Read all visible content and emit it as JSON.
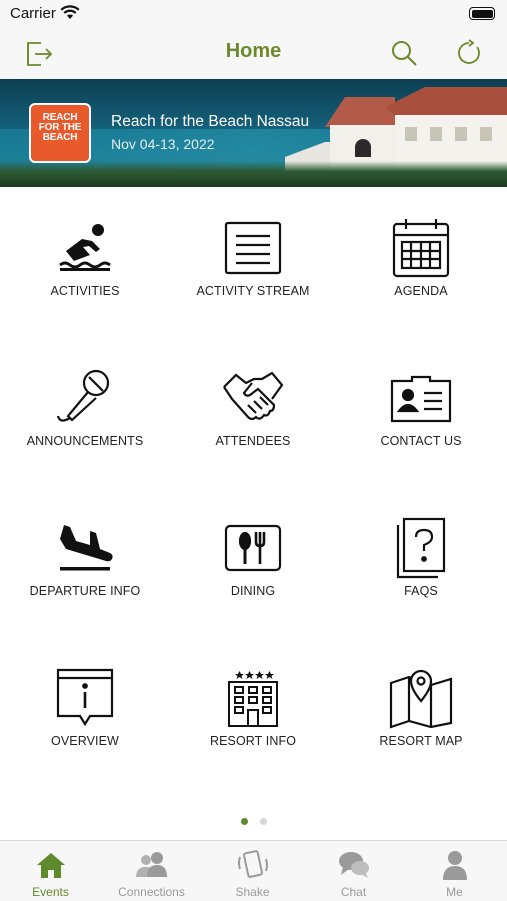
{
  "status_bar": {
    "carrier": "Carrier"
  },
  "nav": {
    "title": "Home"
  },
  "banner": {
    "title": "Reach for the Beach Nassau",
    "date": "Nov 04-13, 2022",
    "logo_text": "REACH FOR THE BEACH"
  },
  "grid": [
    {
      "label": "ACTIVITIES",
      "icon": "swimmer-icon"
    },
    {
      "label": "ACTIVITY STREAM",
      "icon": "list-lines-icon"
    },
    {
      "label": "AGENDA",
      "icon": "calendar-icon"
    },
    {
      "label": "ANNOUNCEMENTS",
      "icon": "microphone-icon"
    },
    {
      "label": "ATTENDEES",
      "icon": "handshake-icon"
    },
    {
      "label": "CONTACT US",
      "icon": "contact-card-icon"
    },
    {
      "label": "DEPARTURE INFO",
      "icon": "plane-landing-icon"
    },
    {
      "label": "DINING",
      "icon": "dining-icon"
    },
    {
      "label": "FAQS",
      "icon": "question-papers-icon"
    },
    {
      "label": "OVERVIEW",
      "icon": "info-sign-icon"
    },
    {
      "label": "RESORT INFO",
      "icon": "hotel-icon"
    },
    {
      "label": "RESORT MAP",
      "icon": "map-pin-icon"
    }
  ],
  "pagination": {
    "pages": 2,
    "current": 1
  },
  "tabs": [
    {
      "label": "Events",
      "icon": "home-icon",
      "active": true
    },
    {
      "label": "Connections",
      "icon": "people-icon",
      "active": false
    },
    {
      "label": "Shake",
      "icon": "phone-shake-icon",
      "active": false
    },
    {
      "label": "Chat",
      "icon": "chat-bubbles-icon",
      "active": false
    },
    {
      "label": "Me",
      "icon": "person-icon",
      "active": false
    }
  ],
  "colors": {
    "accent": "#6c8a2b",
    "tab_inactive": "#9a9a9a"
  }
}
